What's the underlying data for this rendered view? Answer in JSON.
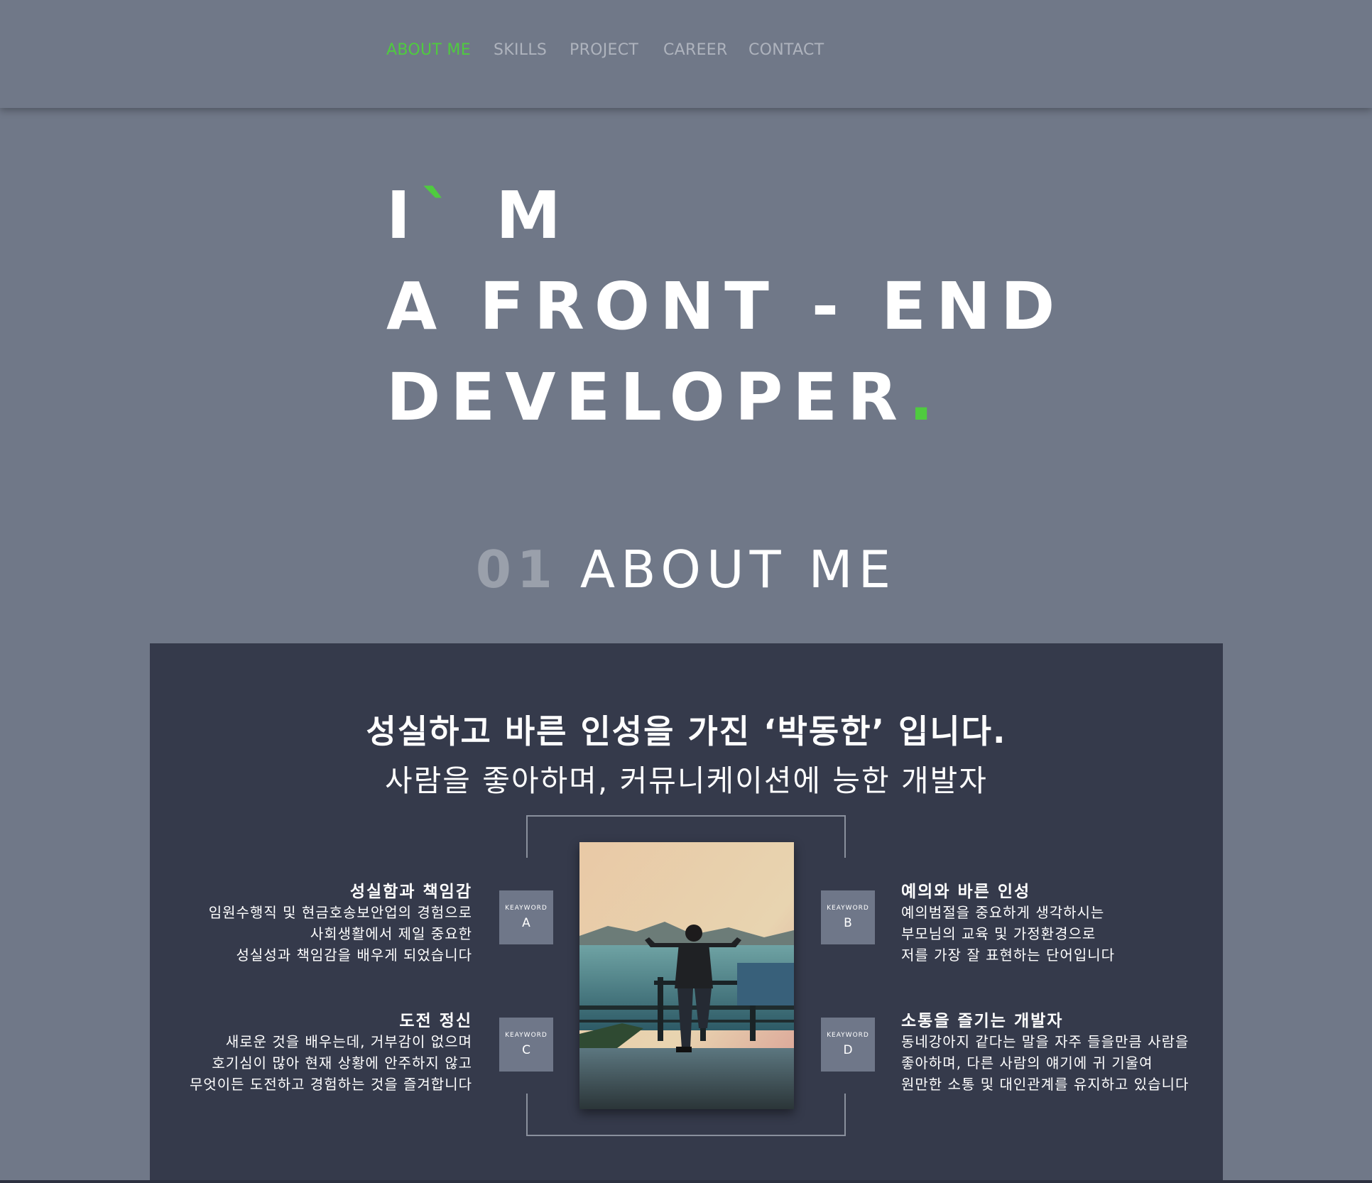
{
  "nav": {
    "items": [
      "ABOUT ME",
      "SKILLS",
      "PROJECT",
      "CAREER",
      "CONTACT"
    ],
    "active_index": 0
  },
  "hero": {
    "line1_a": "I",
    "line1_tick": "`",
    "line1_b": "M",
    "line2": "A FRONT - END",
    "line3": "DEVELOPER",
    "line3_dot": "."
  },
  "section": {
    "number": "01",
    "title": "ABOUT ME"
  },
  "about": {
    "headline": "성실하고 바른 인성을 가진 ‘박동한’ 입니다.",
    "subline": "사람을 좋아하며, 커뮤니케이션에 능한 개발자",
    "keyword_label": "KEAYWORD",
    "keywords": [
      {
        "letter": "A",
        "title": "성실함과 책임감",
        "lines": [
          "임원수행직 및 현금호송보안업의 경험으로",
          "사회생활에서 제일 중요한",
          "성실성과 책임감을 배우게 되었습니다"
        ]
      },
      {
        "letter": "B",
        "title": "예의와 바른 인성",
        "lines": [
          "예의범절을 중요하게 생각하시는",
          "부모님의 교육 및 가정환경으로",
          "저를 가장 잘 표현하는 단어입니다"
        ]
      },
      {
        "letter": "C",
        "title": "도전 정신",
        "lines": [
          "새로운 것을 배우는데, 거부감이 없으며",
          "호기심이 많아 현재 상황에 안주하지 않고",
          "무엇이든 도전하고 경험하는 것을 즐겨합니다"
        ]
      },
      {
        "letter": "D",
        "title": "소통을 즐기는 개발자",
        "lines": [
          "동네강아지 같다는 말을 자주 들을만큼 사람을",
          "좋아하며, 다른 사람의 얘기에 귀 기울여",
          "원만한 소통 및 대인관계를 유지하고 있습니다"
        ]
      }
    ]
  },
  "colors": {
    "accent": "#4fcb3f",
    "background": "#707888",
    "panel": "#353a4b",
    "keyword_box": "#6f7789"
  }
}
